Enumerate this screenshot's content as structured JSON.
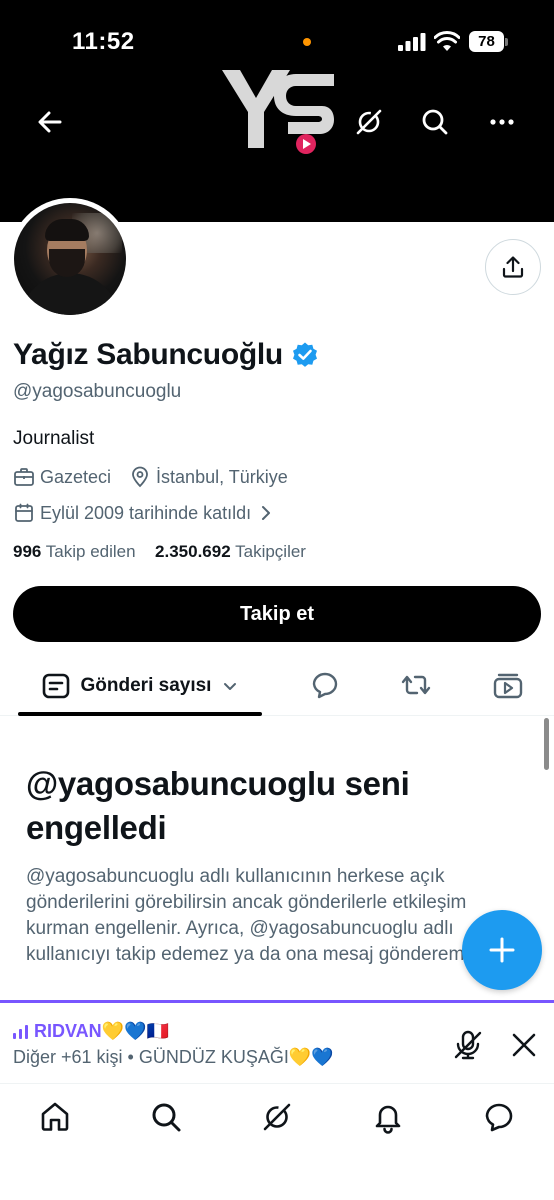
{
  "status_bar": {
    "time": "11:52",
    "battery": "78"
  },
  "header": {
    "logo_text": "YS",
    "icons": [
      "back-arrow-icon",
      "grok-icon",
      "search-icon",
      "more-icon"
    ]
  },
  "profile": {
    "name": "Yağız Sabuncuoğlu",
    "handle": "@yagosabuncuoglu",
    "bio": "Journalist",
    "category": "Gazeteci",
    "location": "İstanbul, Türkiye",
    "joined": "Eylül 2009 tarihinde katıldı",
    "following_count": "996",
    "following_label": "Takip edilen",
    "followers_count": "2.350.692",
    "followers_label": "Takipçiler",
    "follow_button": "Takip et"
  },
  "tabs": {
    "active_label": "Gönderi sayısı"
  },
  "blocked": {
    "title": "@yagosabuncuoglu seni engelledi",
    "text": "@yagosabuncuoglu adlı kullanıcının herkese açık gönderilerini görebilirsin ancak gönderilerle etkileşim kurman engellenir. Ayrıca, @yagosabuncuoglu adlı kullanıcıyı takip edemez ya da ona mesaj gönderemezsin."
  },
  "space": {
    "host": "RIDVAN💛💙🇫🇷",
    "subtitle": "Diğer +61 kişi • GÜNDÜZ KUŞAĞI💛💙"
  },
  "colors": {
    "accent": "#1d9bf0",
    "spaces": "#7856ff",
    "muted": "#536471"
  }
}
